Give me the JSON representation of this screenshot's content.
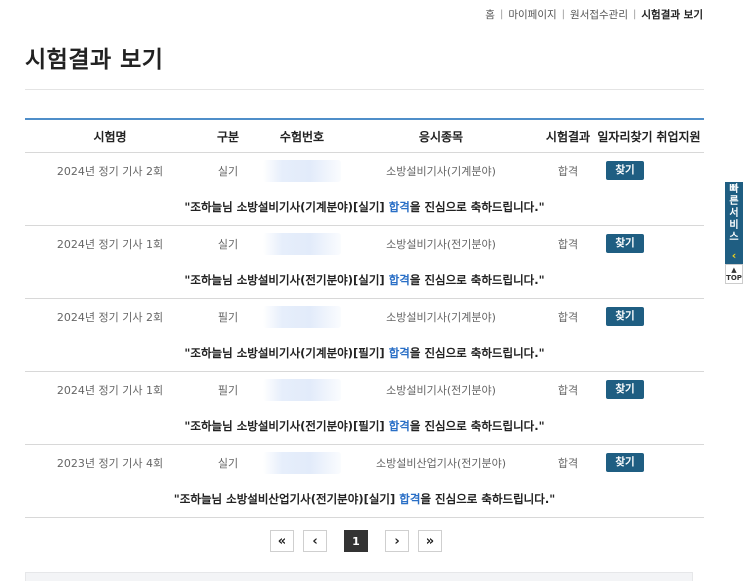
{
  "breadcrumb": {
    "items": [
      "홈",
      "마이페이지",
      "원서접수관리",
      "시험결과 보기"
    ],
    "separator": "|"
  },
  "page": {
    "title": "시험결과 보기"
  },
  "table": {
    "headers": {
      "name": "시험명",
      "type": "구분",
      "number": "수험번호",
      "item": "응시종목",
      "result": "시험결과",
      "job": "일자리찾기",
      "support": "취업지원"
    },
    "rows": [
      {
        "name": "2024년 정기 기사 2회",
        "type": "실기",
        "item": "소방설비기사(기계분야)",
        "result": "합격",
        "job_button": "찾기",
        "msg_prefix": "\"조하늘님 소방설비기사(기계분야)[실기] ",
        "msg_pass": "합격",
        "msg_suffix": "을 진심으로 축하드립니다.\""
      },
      {
        "name": "2024년 정기 기사 1회",
        "type": "실기",
        "item": "소방설비기사(전기분야)",
        "result": "합격",
        "job_button": "찾기",
        "msg_prefix": "\"조하늘님 소방설비기사(전기분야)[실기] ",
        "msg_pass": "합격",
        "msg_suffix": "을 진심으로 축하드립니다.\""
      },
      {
        "name": "2024년 정기 기사 2회",
        "type": "필기",
        "item": "소방설비기사(기계분야)",
        "result": "합격",
        "job_button": "찾기",
        "msg_prefix": "\"조하늘님 소방설비기사(기계분야)[필기] ",
        "msg_pass": "합격",
        "msg_suffix": "을 진심으로 축하드립니다.\""
      },
      {
        "name": "2024년 정기 기사 1회",
        "type": "필기",
        "item": "소방설비기사(전기분야)",
        "result": "합격",
        "job_button": "찾기",
        "msg_prefix": "\"조하늘님 소방설비기사(전기분야)[필기] ",
        "msg_pass": "합격",
        "msg_suffix": "을 진심으로 축하드립니다.\""
      },
      {
        "name": "2023년 정기 기사 4회",
        "type": "실기",
        "item": "소방설비산업기사(전기분야)",
        "result": "합격",
        "job_button": "찾기",
        "msg_prefix": "\"조하늘님 소방설비산업기사(전기분야)[실기] ",
        "msg_pass": "합격",
        "msg_suffix": "을 진심으로 축하드립니다.\""
      }
    ]
  },
  "pagination": {
    "first": "«",
    "prev": "‹",
    "current": "1",
    "next": "›",
    "last": "»"
  },
  "quick_menu": {
    "label": "빠른서비스",
    "collapse_arrow": "‹",
    "top_arrow": "▲",
    "top_label": "TOP"
  },
  "colors": {
    "accent_line": "#4f8ec9",
    "button": "#1f5e82",
    "pass_text": "#2a6fc6",
    "arrow": "#f2d21c"
  },
  "icons": {
    "quick_arrow": "chevron-left-icon",
    "top": "caret-up-icon"
  }
}
